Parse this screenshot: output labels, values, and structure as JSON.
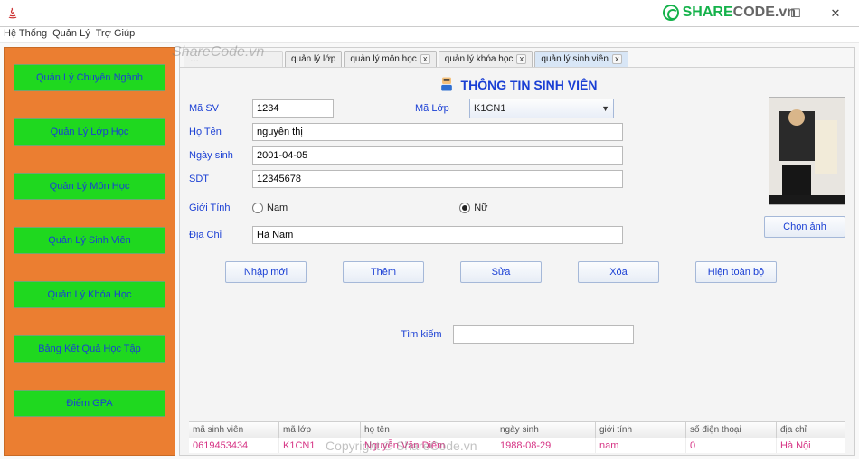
{
  "window": {
    "min": "—",
    "max": "☐",
    "close": "✕"
  },
  "menubar": [
    "Hệ Thống",
    "Quản Lý",
    "Trợ Giúp"
  ],
  "brand": {
    "a": "SHARE",
    "b": "CODE",
    "suffix": ".vn"
  },
  "sidebar": {
    "items": [
      "Quản Lý Chuyên Ngành",
      "Quản Lý Lớp Học",
      "Quản Lý Môn Học",
      "Quản Lý Sinh Viên",
      "Quản Lý Khóa Học",
      "Bảng Kết Quả Học Tập",
      "Điểm GPA"
    ]
  },
  "tabs": [
    {
      "label": "quản lý lớp",
      "closable": false
    },
    {
      "label": "quản lý môn học",
      "closable": true
    },
    {
      "label": "quản lý khóa học",
      "closable": true
    },
    {
      "label": "quản lý sinh viên",
      "closable": true,
      "active": true
    }
  ],
  "title": "THÔNG TIN SINH VIÊN",
  "form": {
    "masv_label": "Mã SV",
    "masv_value": "1234",
    "malop_label": "Mã Lớp",
    "malop_value": "K1CN1",
    "hoten_label": "Họ Tên",
    "hoten_value": "nguyễn thị",
    "ngaysinh_label": "Ngày sinh",
    "ngaysinh_value": "2001-04-05",
    "sdt_label": "SDT",
    "sdt_value": "12345678",
    "gioitinh_label": "Giới Tính",
    "radio_nam": "Nam",
    "radio_nu": "Nữ",
    "gioitinh_selected": "Nữ",
    "diachi_label": "Địa Chỉ",
    "diachi_value": "Hà Nam",
    "chonanh": "Chọn ảnh"
  },
  "actions": {
    "nhapmoi": "Nhập mới",
    "them": "Thêm",
    "sua": "Sửa",
    "xoa": "Xóa",
    "hientoanbo": "Hiện toàn bộ"
  },
  "search": {
    "label": "Tìm kiếm",
    "value": ""
  },
  "table": {
    "headers": [
      "mã sinh viên",
      "mã lớp",
      "họ tên",
      "ngày sinh",
      "giới tính",
      "số điện thoại",
      "địa chỉ"
    ],
    "rows": [
      {
        "masv": "0619453434",
        "malop": "K1CN1",
        "hoten": "Nguyễn Văn Diêm",
        "ngaysinh": "1988-08-29",
        "gioitinh": "nam",
        "sdt": "0",
        "diachi": "Hà Nội"
      }
    ]
  },
  "watermark1": "ShareCode.vn",
  "watermark2": "Copyright © ShareCode.vn"
}
